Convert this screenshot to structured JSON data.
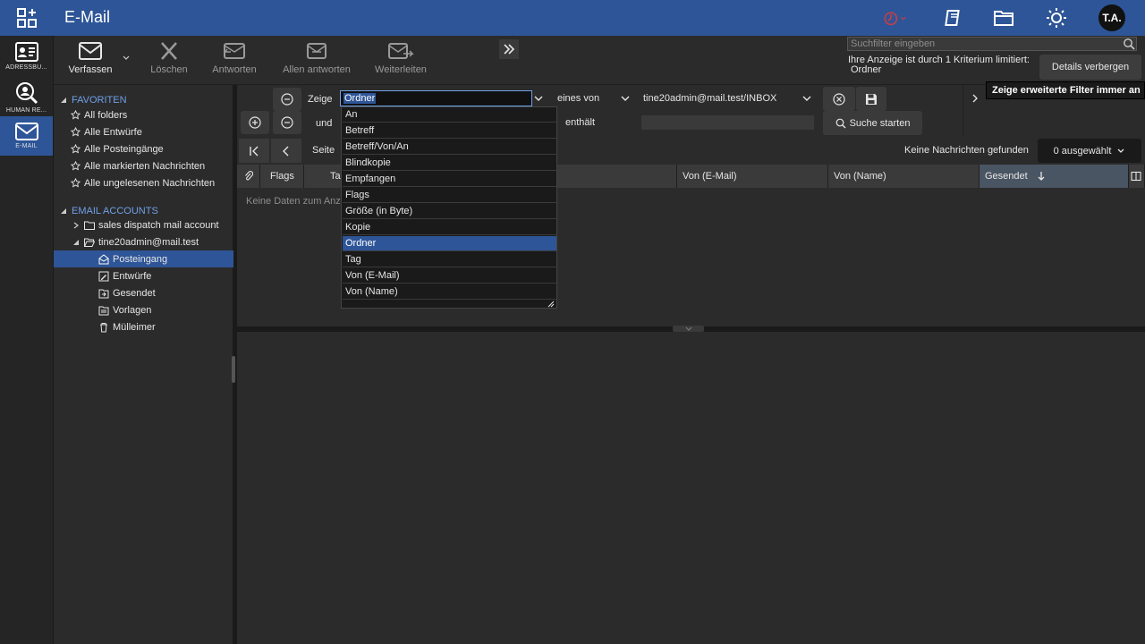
{
  "topbar": {
    "title": "E-Mail",
    "avatar_initials": "T.A.",
    "icons": [
      "apps-grid-icon",
      "timer-icon",
      "book-icon",
      "folder-icon",
      "sun-icon"
    ]
  },
  "modules": [
    {
      "label": "ADRESSBU..."
    },
    {
      "label": "HUMAN RE..."
    },
    {
      "label": "E-MAIL"
    }
  ],
  "toolbar": {
    "compose": "Verfassen",
    "delete": "Löschen",
    "reply": "Antworten",
    "reply_all": "Allen antworten",
    "forward": "Weiterleiten"
  },
  "search": {
    "placeholder": "Suchfilter eingeben",
    "filter_info_line1": "Ihre Anzeige ist durch 1 Kriterium limitiert:",
    "filter_info_line2": "Ordner",
    "details_button": "Details verbergen",
    "tooltip": "Zeige erweiterte Filter immer an"
  },
  "tree": {
    "favorites_label": "FAVORITEN",
    "favorites": [
      "All folders",
      "Alle Entwürfe",
      "Alle Posteingänge",
      "Alle markierten Nachrichten",
      "Alle ungelesenen Nachrichten"
    ],
    "accounts_label": "EMAIL ACCOUNTS",
    "account1": "sales dispatch mail account",
    "account2": "tine20admin@mail.test",
    "folders": [
      "Posteingang",
      "Entwürfe",
      "Gesendet",
      "Vorlagen",
      "Mülleimer"
    ]
  },
  "filter": {
    "row1_label": "Zeige",
    "field_value": "Ordner",
    "operator": "eines von",
    "value": "tine20admin@mail.test/INBOX",
    "row2_label": "und",
    "row2_operator": "enthält",
    "search_start": "Suche starten"
  },
  "dropdown": {
    "options": [
      "An",
      "Betreff",
      "Betreff/Von/An",
      "Blindkopie",
      "Empfangen",
      "Flags",
      "Größe (in Byte)",
      "Kopie",
      "Ordner",
      "Tag",
      "Von (E-Mail)",
      "Von (Name)"
    ],
    "selected": "Ordner"
  },
  "paging": {
    "page_label": "Seite",
    "no_messages": "Keine Nachrichten gefunden",
    "selected_count": "0 ausgewählt"
  },
  "grid": {
    "columns": [
      "Flags",
      "Ta",
      "Von (E-Mail)",
      "Von (Name)",
      "Gesendet"
    ],
    "no_data": "Keine Daten zum Anz..."
  }
}
